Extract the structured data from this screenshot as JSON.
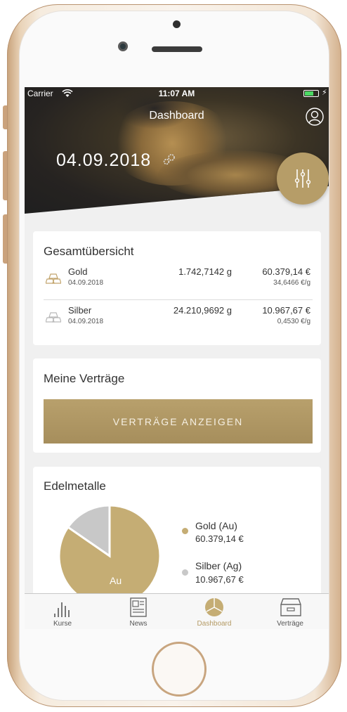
{
  "status_bar": {
    "carrier": "Carrier",
    "time": "11:07 AM"
  },
  "header": {
    "title": "Dashboard",
    "date": "04.09.2018"
  },
  "overview": {
    "title": "Gesamtübersicht",
    "rows": [
      {
        "name": "Gold",
        "date": "04.09.2018",
        "weight": "1.742,7142 g",
        "value": "60.379,14 €",
        "unit_price": "34,6466 €/g"
      },
      {
        "name": "Silber",
        "date": "04.09.2018",
        "weight": "24.210,9692 g",
        "value": "10.967,67 €",
        "unit_price": "0,4530 €/g"
      }
    ]
  },
  "contracts": {
    "title": "Meine Verträge",
    "button_label": "VERTRÄGE ANZEIGEN"
  },
  "metals": {
    "title": "Edelmetalle",
    "pie_label": "Au",
    "legend": [
      {
        "name": "Gold (Au)",
        "value": "60.379,14 €",
        "color": "#c5ad74"
      },
      {
        "name": "Silber (Ag)",
        "value": "10.967,67 €",
        "color": "#c8c8c8"
      }
    ]
  },
  "chart_data": {
    "type": "pie",
    "categories": [
      "Gold (Au)",
      "Silber (Ag)"
    ],
    "values": [
      60379.14,
      10967.67
    ],
    "colors": [
      "#c5ad74",
      "#c8c8c8"
    ]
  },
  "tabbar": {
    "items": [
      {
        "label": "Kurse",
        "icon": "bar-chart-icon"
      },
      {
        "label": "News",
        "icon": "newspaper-icon"
      },
      {
        "label": "Dashboard",
        "icon": "dashboard-icon",
        "active": true
      },
      {
        "label": "Verträge",
        "icon": "archive-box-icon"
      }
    ]
  },
  "colors": {
    "accent": "#b49a64",
    "hero_dark": "#262321"
  }
}
